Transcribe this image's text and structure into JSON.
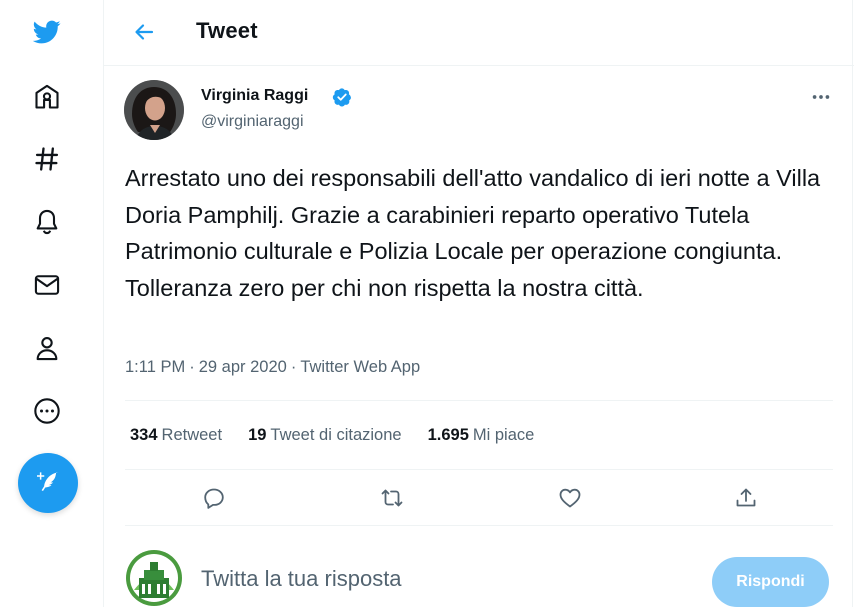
{
  "colors": {
    "accent": "#1d9bf0",
    "text": "#0f1419",
    "secondary": "#536471",
    "divider": "#eff3f4",
    "reply_button_disabled": "#8ecdf8"
  },
  "nav": {
    "icons": [
      "twitter-logo-icon",
      "home-icon",
      "explore-hashtag-icon",
      "notifications-bell-icon",
      "messages-envelope-icon",
      "profile-person-icon",
      "more-circle-icon",
      "compose-tweet-icon"
    ]
  },
  "header": {
    "title": "Tweet",
    "back_icon": "arrow-left-icon"
  },
  "tweet": {
    "author": {
      "name": "Virginia Raggi",
      "handle": "@virginiaraggi",
      "verified": true
    },
    "text": "Arrestato uno dei responsabili dell'atto vandalico di ieri notte a Villa Doria Pamphilj. Grazie a carabinieri reparto operativo Tutela Patrimonio culturale e Polizia Locale per operazione congiunta. Tolleranza zero per chi non rispetta la nostra città.",
    "time": "1:11 PM",
    "date": "29 apr 2020",
    "source": "Twitter Web App",
    "separator": "·",
    "stats": {
      "retweets": {
        "value": "334",
        "label": "Retweet"
      },
      "quotes": {
        "value": "19",
        "label": "Tweet di citazione"
      },
      "likes": {
        "value": "1.695",
        "label": "Mi piace"
      }
    },
    "action_icons": [
      "reply-icon",
      "retweet-icon",
      "like-heart-icon",
      "share-icon"
    ]
  },
  "reply": {
    "placeholder": "Twitta la tua risposta",
    "button_label": "Rispondi"
  }
}
